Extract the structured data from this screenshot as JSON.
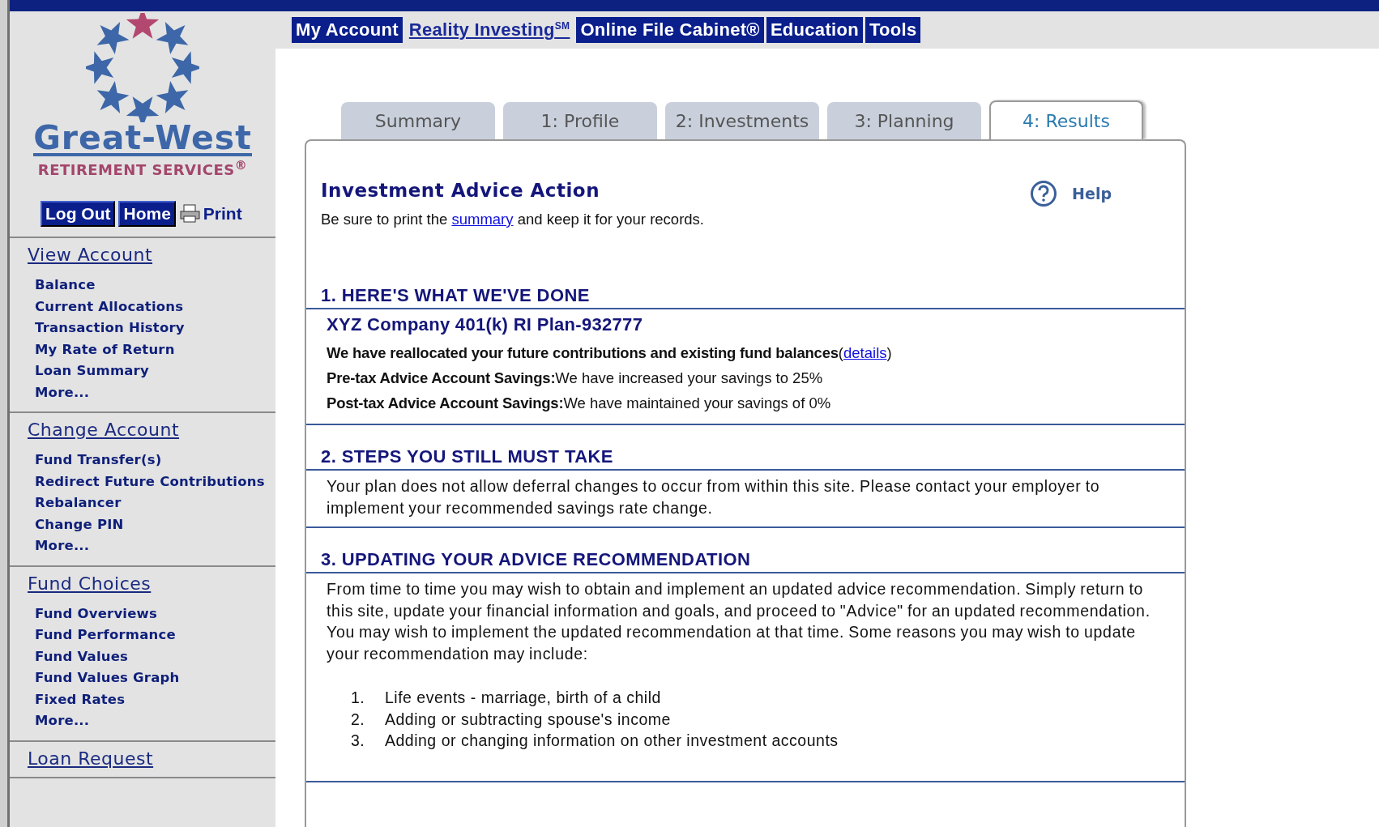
{
  "logo": {
    "name": "Great-West",
    "tagline": "RETIREMENT SERVICES$^{®}$"
  },
  "account_buttons": [
    {
      "label": "Log Out",
      "kind": "button"
    },
    {
      "label": "Home",
      "kind": "button"
    },
    {
      "label": "Print",
      "kind": "print"
    }
  ],
  "sidebar": {
    "sections": [
      {
        "title": "View Account",
        "items": [
          "Balance",
          "Current Allocations",
          "Transaction History",
          "My Rate of Return",
          "Loan Summary",
          "More..."
        ]
      },
      {
        "title": "Change Account",
        "items": [
          "Fund Transfer(s)",
          "Redirect Future Contributions",
          "Rebalancer",
          "Change PIN",
          "More..."
        ]
      },
      {
        "title": "Fund Choices",
        "items": [
          "Fund Overviews",
          "Fund Performance",
          "Fund Values",
          "Fund Values Graph",
          "Fixed Rates",
          "More..."
        ]
      },
      {
        "title": "Loan Request"
      }
    ]
  },
  "top_nav": [
    {
      "label": "My Account",
      "kind": "box"
    },
    {
      "label": "Reality Investing$^{SM}$",
      "kind": "link"
    },
    {
      "label": "Online File Cabinet®",
      "kind": "box"
    },
    {
      "label": "Education",
      "kind": "box"
    },
    {
      "label": "Tools",
      "kind": "box"
    }
  ],
  "tabs": [
    {
      "label": "Summary",
      "selected": false
    },
    {
      "label": "1: Profile",
      "selected": false
    },
    {
      "label": "2: Investments",
      "selected": false
    },
    {
      "label": "3: Planning",
      "selected": false
    },
    {
      "label": "4: Results",
      "selected": true
    }
  ],
  "panel": {
    "title": "Investment Advice Action",
    "help": "Help",
    "note": {
      "before": "Be sure to print the",
      "link": "summary",
      "after": "and keep it for your records."
    },
    "sections": [
      {
        "heading": "1. HERE'S WHAT WE'VE DONE",
        "plan": "XYZ Company 401(k) RI Plan-932777",
        "lines": [
          {
            "text": "**We have reallocated your future contributions and existing fund balances**(",
            "link": "details",
            "after": ")"
          },
          {
            "text": "**Pre-tax Advice Account Savings:**We have increased your savings to 25%"
          },
          {
            "text": "**Post-tax Advice Account Savings:**We have maintained your savings of 0%"
          }
        ]
      },
      {
        "heading": "2. STEPS YOU STILL MUST TAKE",
        "paragraph": "Your plan does not allow deferral changes to occur from within this site. Please contact your employer to implement your recommended savings rate change."
      },
      {
        "heading": "3. UPDATING YOUR ADVICE RECOMMENDATION",
        "paragraph": "From time to time you may wish to obtain and implement an updated advice recommendation. Simply return to this site, update your financial information and goals, and proceed to \"Advice\" for an updated recommendation. You may wish to implement the updated recommendation at that time. Some reasons you may wish to update your recommendation may include:",
        "list": [
          {
            "number": "1.",
            "text": "Life events - marriage, birth of a child"
          },
          {
            "number": "2.",
            "text": "Adding or subtracting spouse's income"
          },
          {
            "number": "3.",
            "text": "Adding or changing information on other investment accounts"
          }
        ]
      }
    ]
  }
}
